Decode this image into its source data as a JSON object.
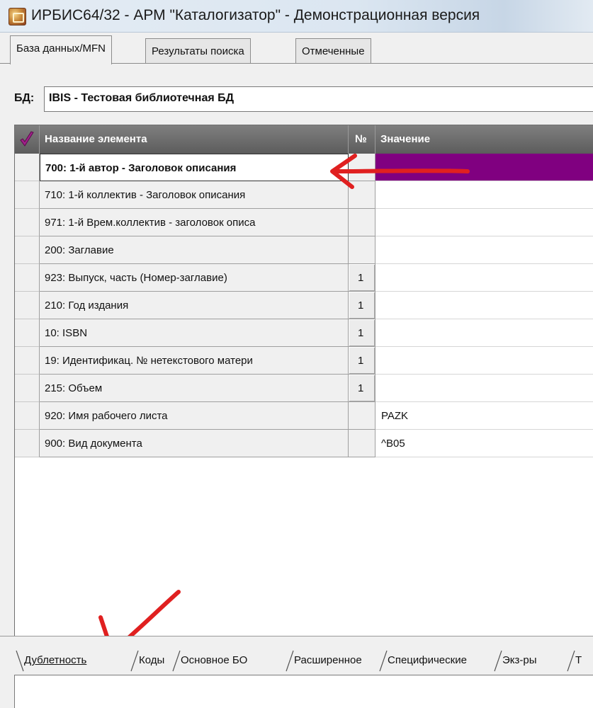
{
  "window": {
    "title": "ИРБИС64/32 - АРМ \"Каталогизатор\" - Демонстрационная версия"
  },
  "top_tabs": [
    {
      "label": "База данных/MFN"
    },
    {
      "label": "Результаты поиска"
    },
    {
      "label": "Отмеченные"
    }
  ],
  "db": {
    "label": "БД:",
    "value": "IBIS - Тестовая библиотечная БД"
  },
  "grid": {
    "headers": {
      "name": "Название элемента",
      "num": "№",
      "value": "Значение"
    },
    "rows": [
      {
        "name": "700: 1-й  автор - Заголовок описания",
        "num": "",
        "value": ""
      },
      {
        "name": "710: 1-й коллектив - Заголовок описания",
        "num": "",
        "value": ""
      },
      {
        "name": "971: 1-й Врем.коллектив - заголовок описа",
        "num": "",
        "value": ""
      },
      {
        "name": "200: Заглавие",
        "num": "",
        "value": ""
      },
      {
        "name": "923: Выпуск, часть (Номер-заглавие)",
        "num": "1",
        "value": ""
      },
      {
        "name": "210: Год издания",
        "num": "1",
        "value": ""
      },
      {
        "name": "10: ISBN",
        "num": "1",
        "value": ""
      },
      {
        "name": "19: Идентификац. № нетекстового матери",
        "num": "1",
        "value": ""
      },
      {
        "name": "215: Объем",
        "num": "1",
        "value": ""
      },
      {
        "name": "920: Имя рабочего листа",
        "num": "",
        "value": "PAZK"
      },
      {
        "name": "900: Вид документа",
        "num": "",
        "value": "^B05"
      }
    ],
    "selected_value_color": "#800080"
  },
  "bottom_tabs": [
    {
      "label": "Дублетность"
    },
    {
      "label": "Коды"
    },
    {
      "label": "Основное БО"
    },
    {
      "label": "Расширенное"
    },
    {
      "label": "Специфические"
    },
    {
      "label": "Экз-ры"
    },
    {
      "label": "Т"
    }
  ],
  "annotation_color": "#e02020"
}
